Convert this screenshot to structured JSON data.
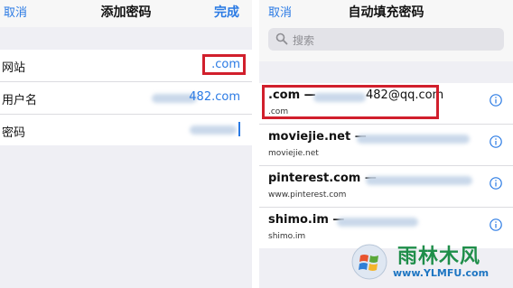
{
  "left": {
    "nav": {
      "cancel": "取消",
      "title": "添加密码",
      "done": "完成"
    },
    "fields": [
      {
        "label": "网站",
        "value": ".com"
      },
      {
        "label": "用户名",
        "value": "482.com"
      },
      {
        "label": "密码",
        "value": ""
      }
    ]
  },
  "right": {
    "nav": {
      "cancel": "取消",
      "title": "自动填充密码"
    },
    "search": {
      "placeholder": "搜索"
    },
    "items": [
      {
        "title": ".com —",
        "title_tail": "482@qq.com",
        "subtitle": ".com"
      },
      {
        "title": "moviejie.net —",
        "title_tail": "",
        "subtitle": "moviejie.net"
      },
      {
        "title": "pinterest.com —",
        "title_tail": "",
        "subtitle": "www.pinterest.com"
      },
      {
        "title": "shimo.im —",
        "title_tail": "",
        "subtitle": "shimo.im"
      }
    ]
  },
  "watermark": {
    "name": "雨林木风",
    "url": "www.YLMFU.com"
  },
  "colors": {
    "accent": "#2a7ae4",
    "highlight": "#d11f2c",
    "watermark_green": "#1f8e4a",
    "watermark_blue": "#1d75c2"
  }
}
